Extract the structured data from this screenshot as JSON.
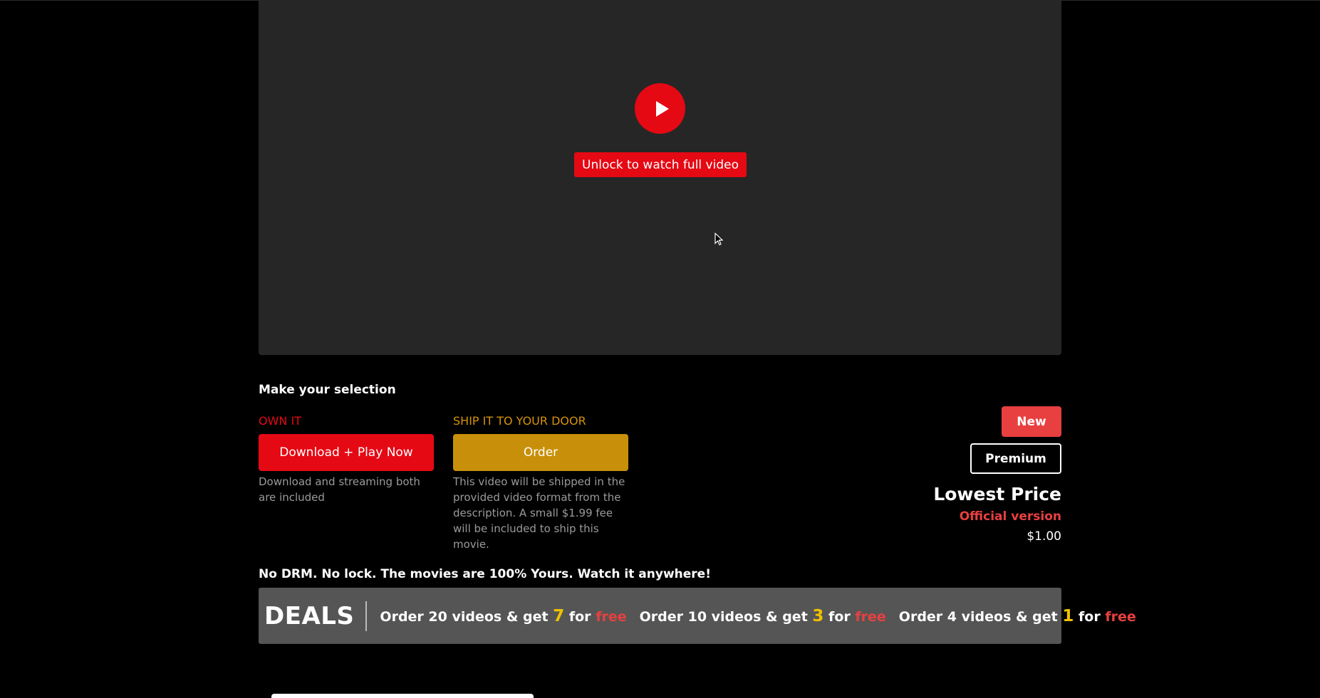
{
  "player": {
    "unlock_label": "Unlock to watch full video"
  },
  "selection": {
    "title": "Make your selection",
    "own": {
      "label": "OWN IT",
      "button": "Download + Play Now",
      "description": "Download and streaming both are included"
    },
    "ship": {
      "label": "SHIP IT TO YOUR DOOR",
      "button": "Order",
      "description": "This video will be shipped in the provided video format from the description. A small $1.99 fee will be included to ship this movie."
    }
  },
  "pricing": {
    "new_label": "New",
    "premium_label": "Premium",
    "lowest_price": "Lowest Price",
    "official": "Official version",
    "price": "$1.00"
  },
  "nodrm": "No DRM. No lock. The movies are 100% Yours. Watch it anywhere!",
  "deals": {
    "title": "DEALS",
    "items": [
      {
        "prefix": "Order 20 videos & get",
        "num": "7",
        "for": "for",
        "free": "free"
      },
      {
        "prefix": "Order 10 videos & get",
        "num": "3",
        "for": "for",
        "free": "free"
      },
      {
        "prefix": "Order 4 videos & get",
        "num": "1",
        "for": "for",
        "free": "free"
      }
    ]
  },
  "colors": {
    "accent_red": "#e50914",
    "order_gold": "#c8900a",
    "deal_number": "#f0c000"
  }
}
